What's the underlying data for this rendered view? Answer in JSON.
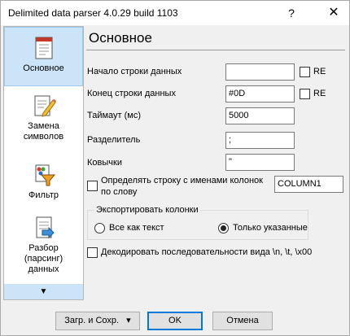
{
  "window": {
    "title": "Delimited data parser 4.0.29 build 1103",
    "help_glyph": "?",
    "close_glyph": "✕"
  },
  "sidebar": {
    "items": [
      {
        "label": "Основное",
        "icon": "document-icon",
        "selected": true
      },
      {
        "label": "Замена символов",
        "icon": "edit-document-icon",
        "selected": false
      },
      {
        "label": "Фильтр",
        "icon": "filter-funnel-icon",
        "selected": false
      },
      {
        "label": "Разбор (парсинг) данных",
        "icon": "parse-data-icon",
        "selected": false
      }
    ],
    "scroll_down_glyph": "▼"
  },
  "page": {
    "title": "Основное",
    "fields": {
      "start_line": {
        "label": "Начало строки данных",
        "value": "",
        "re_label": "RE",
        "re_checked": false
      },
      "end_line": {
        "label": "Конец строки данных",
        "value": "#0D",
        "re_label": "RE",
        "re_checked": false
      },
      "timeout": {
        "label": "Таймаут (мс)",
        "value": "5000"
      },
      "delimiter": {
        "label": "Разделитель",
        "value": ";"
      },
      "quotes": {
        "label": "Ковычки",
        "value": "\""
      }
    },
    "header_row": {
      "label": "Определять строку с именами колонок по слову",
      "checked": false,
      "value": "COLUMN1"
    },
    "export_group": {
      "title": "Экспортировать колонки",
      "options": [
        {
          "label": "Все как текст",
          "selected": false
        },
        {
          "label": "Только указанные",
          "selected": true
        }
      ]
    },
    "decode_escapes": {
      "label": "Декодировать последовательности вида \\n, \\t, \\x00",
      "checked": false
    }
  },
  "buttons": {
    "load_save": "Загр. и Сохр.",
    "load_save_arrow": "▾",
    "ok": "OK",
    "cancel": "Отмена"
  },
  "colors": {
    "sidebar_selected": "#cce4f7",
    "default_button_border": "#0078d7"
  }
}
